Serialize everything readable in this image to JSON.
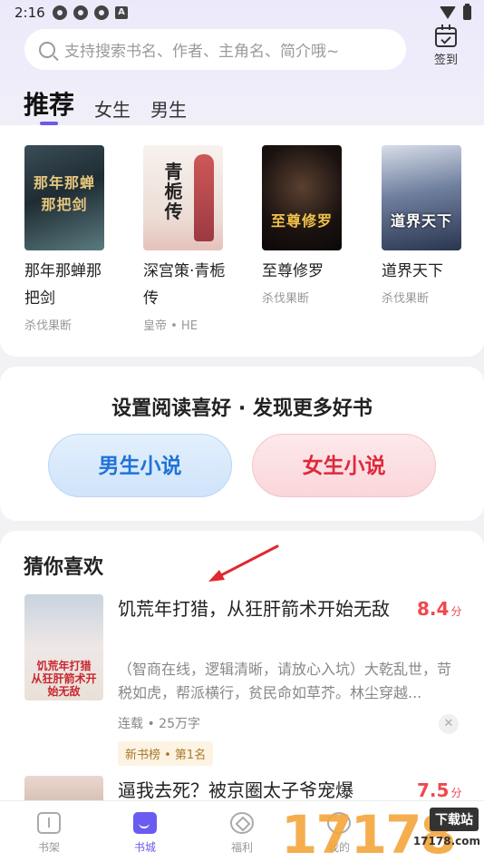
{
  "status_bar": {
    "time": "2:16",
    "a_badge": "A"
  },
  "search": {
    "placeholder": "支持搜索书名、作者、主角名、简介哦~"
  },
  "signin": {
    "label": "签到"
  },
  "tabs": [
    {
      "label": "推荐",
      "active": true
    },
    {
      "label": "女生",
      "active": false
    },
    {
      "label": "男生",
      "active": false
    }
  ],
  "recommend": [
    {
      "title": "那年那蝉那把剑",
      "author": "杀伐果断",
      "cover_text": "那年那蝉\n那把剑",
      "cover_colors": [
        "#2b3b45",
        "#6b8a91",
        "#c8b27a"
      ]
    },
    {
      "title": "深宫策·青栀传",
      "author": "皇帝 • HE",
      "cover_text": "青\n栀\n传",
      "cover_colors": [
        "#f3ece6",
        "#e8d3cc",
        "#c63a3a"
      ]
    },
    {
      "title": "至尊修罗",
      "author": "杀伐果断",
      "cover_text": "至尊修罗",
      "cover_colors": [
        "#140f0e",
        "#3a2a22",
        "#e2b447"
      ]
    },
    {
      "title": "道界天下",
      "author": "杀伐果断",
      "cover_text": "道界天下",
      "cover_colors": [
        "#2e3a52",
        "#9aa7c2",
        "#ffffff"
      ]
    }
  ],
  "preference": {
    "title": "设置阅读喜好 · 发现更多好书",
    "male_label": "男生小说",
    "female_label": "女生小说"
  },
  "guess": {
    "title": "猜你喜欢",
    "items": [
      {
        "title": "饥荒年打猎，从狂肝箭术开始无敌",
        "score": "8.4",
        "score_unit": "分",
        "desc": "（智商在线，逻辑清晰，请放心入坑）大乾乱世，苛税如虎，帮派横行，贫民命如草芥。林尘穿越...",
        "meta": "连载 • 25万字",
        "tag": "新书榜 • 第1名",
        "cover_text": "饥荒年打猎\n从狂肝箭术开始无敌"
      },
      {
        "title": "逼我去死？被京圈太子爷宠爆",
        "score": "7.5",
        "score_unit": "分"
      }
    ]
  },
  "close_symbol": "✕",
  "nav": [
    {
      "label": "书架",
      "active": false
    },
    {
      "label": "书城",
      "active": true
    },
    {
      "label": "福利",
      "active": false
    },
    {
      "label": "我的",
      "active": false
    }
  ],
  "watermark": {
    "digits": "17178",
    "badge": "下载站",
    "url": "17178.com"
  },
  "colors": {
    "accent": "#6a5cf0",
    "score": "#f0484e",
    "male": "#1f73d6",
    "female": "#e0283c"
  }
}
